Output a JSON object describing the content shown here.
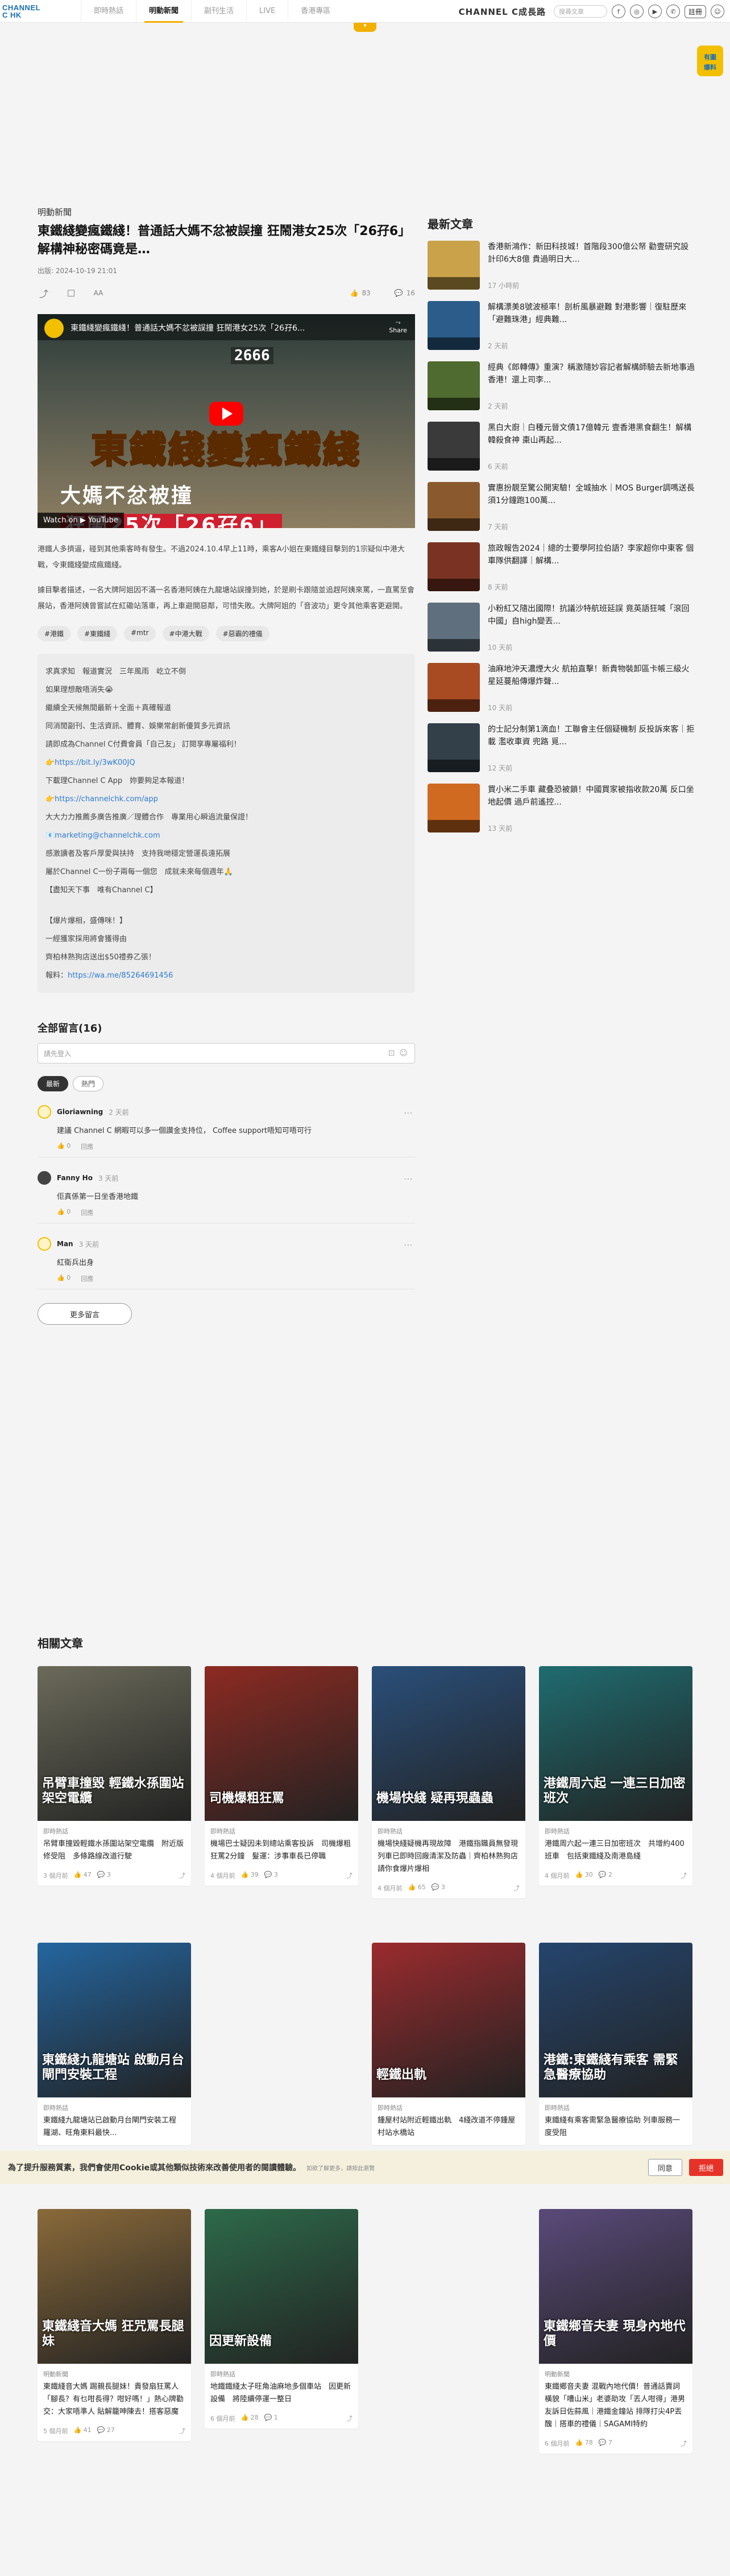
{
  "nav": {
    "logo_line1": "CHANNEL",
    "logo_line2": "C HK",
    "tabs": [
      {
        "label": "即時熱話"
      },
      {
        "label": "明動新聞"
      },
      {
        "label": "副刊生活"
      },
      {
        "label": "LIVE"
      },
      {
        "label": "香港專區"
      }
    ],
    "slogan": "CHANNEL C成長路",
    "search_placeholder": "搜尋文章",
    "login": "註冊",
    "promo_badge": "爆料"
  },
  "article": {
    "section": "明動新聞",
    "headline": "東鐵綫變瘋鐵綫！普通話大媽不忿被誤撞 狂鬧港女25次「26孖6」 解構神秘密碼竟是…",
    "pubdate": "出版: 2024-10-19 21:01",
    "likes": "83",
    "comments_count": "16",
    "video": {
      "title": "東鐵綫變瘋鐵綫！普通話大媽不忿被誤撞 狂鬧港女25次「26孖6...",
      "counter": "2666",
      "big_title": "東鐵綫變瘋鐵綫",
      "sub_prefix": "大媽不忿被撞 ",
      "sub_highlight": "狂鬧25次「26孖6」",
      "share": "Share",
      "watch_on": "Watch on ▶ YouTube"
    },
    "paragraphs": [
      "港鐵人多擠逼，碰到其他乘客時有發生。不過2024.10.4早上11時，乘客A小姐在東鐵綫目擊到的1宗疑似中港大戰，令東鐵綫變成瘋鐵綫。",
      "據目擊者描述，一名大牌阿姐因不滿一名香港阿姨在九龍塘站誤撞到她，於是刷卡跟隨並追趕阿姨來罵，一直罵至會展站，香港阿姨曾嘗試在紅磡站落車，再上車避開惡鄰，可惜失敗。大牌阿姐的「音波功」更令其他乘客更避開。"
    ],
    "tags": [
      "#港鐵",
      "#東鐵綫",
      "#mtr",
      "#中港大戰",
      "#惡霸的禮儀"
    ],
    "promo_lines": [
      "求真求知　報道實況　三年風雨　屹立不倒",
      "如果理想敵唔消失😭",
      "繼續全天候無間最新＋全面＋真確報道",
      "同消閒副刊、生活資訊、體育、娛樂常創新優質多元資訊",
      "請即成為Channel C付費會員「自己友」 訂閱享專屬福利！",
      "👉https://bit.ly/3wK00JQ",
      "下載理Channel C App　妳要夠足本報道！",
      "👉https://channelchk.com/app",
      "大大力力推薦多廣告推廣／理體合作　專業用心瞬過流量保證！",
      "📧marketing@channelchk.com",
      "感激讀者及客戶厚愛與扶持　支持我哋穩定營運長遠拓展",
      "屬於Channel C一份子兩每一個您　成就未來每個週年🙏",
      "【盡知天下事　唯有Channel C】"
    ],
    "tip_lines": [
      "【爆片爆相，盛傳咪！】",
      "一經獲家採用將會獲得由",
      "齊柏林熟狗店送出$50禮券乙張！",
      "報料："
    ],
    "tip_link": "https://wa.me/85264691456"
  },
  "comments": {
    "title": "全部留言(16)",
    "placeholder": "請先登入",
    "sort": [
      "最新",
      "熱門"
    ],
    "items": [
      {
        "user": "Gloriawning",
        "time": "2 天前",
        "text": "建議 Channel C 網暇可以多一個讚金支持位， Coffee support唔知可唔可行",
        "likes": "0",
        "reply": "回應"
      },
      {
        "user": "Fanny Ho",
        "time": "3 天前",
        "text": "佢真係第一日坐香港地鐵",
        "likes": "0",
        "reply": "回應"
      },
      {
        "user": "Man",
        "time": "3 天前",
        "text": "紅衛兵出身",
        "likes": "0",
        "reply": "回應"
      }
    ],
    "more": "更多留言"
  },
  "sidebar": {
    "title": "最新文章",
    "items": [
      {
        "title": "香港新鴻作：新田科技城！首階段300億公帑 勸壹研究設計印6大8億 貴過明日大...",
        "time": "17 小時前",
        "color": "#c9a24a"
      },
      {
        "title": "解構漂美8號波極率！剖析風暴避難 對港影響｜復駐歷來「避難珠港」經典難...",
        "time": "2 天前",
        "color": "#2c5d8a"
      },
      {
        "title": "經典《郎轉傳》重演？稱激隨妙容記者解構師驗去新地事過香港！還上司李...",
        "time": "2 天前",
        "color": "#4f6b2f"
      },
      {
        "title": "黑白大廚｜白種元晉文債17億韓元 壹香港黑食翻生！解構韓殺食神 棗山再起...",
        "time": "6 天前",
        "color": "#3a3a3a"
      },
      {
        "title": "實惠扮靚至驚公開実驗！全城抽水｜MOS Burger調嗎送長 須1分鐘跑100萬...",
        "time": "7 天前",
        "color": "#8a5a2e"
      },
      {
        "title": "旅政報告2024｜總的士要學阿拉伯語？李家超你中東客 個車隊供翻譯｜解構...",
        "time": "8 天前",
        "color": "#7a3322"
      },
      {
        "title": "小粉紅又隨出國際！抗議沙特航班延誤 竟英語狂喊「滾回中國」自high變丟...",
        "time": "10 天前",
        "color": "#5f6f7d"
      },
      {
        "title": "油麻地沖天濃煙大火 航拍直擊！新貴物裝卸區卡帳三級火 星延蔓船傳爆炸聲...",
        "time": "10 天前",
        "color": "#a84a22"
      },
      {
        "title": "的士記分制第1滴血！工聯會主任個疑機制 反投訴來客｜拒載 濫收車資 兜路 覓...",
        "time": "12 天前",
        "color": "#33404a"
      },
      {
        "title": "買小米二手車 藏叠恐被鎖！中國買家被指收款20萬 反口坐地起價 過戶前遙控...",
        "time": "13 天前",
        "color": "#d06a20"
      }
    ]
  },
  "related": {
    "title": "相關文章",
    "cards": [
      {
        "section": "即時熱話",
        "title": "吊臂車撞毀輕鐵水孫圍站架空電纜　附近版修受阻　多條路線改道行駛",
        "date": "3 個月前",
        "likes": "47",
        "comments": "3",
        "caption": "吊臂車撞毀 輕鐵水孫圍站架空電纜",
        "color": "#6b6a5a"
      },
      {
        "section": "即時熱話",
        "title": "機場巴士疑因未到總站乘客投訴　司機爆粗狂罵2分鐘　髮運：涉事車長已停職",
        "date": "4 個月前",
        "likes": "39",
        "comments": "3",
        "caption": "司機爆粗狂罵",
        "color": "#8d2a22"
      },
      {
        "section": "即時熱話",
        "title": "機場快綫疑機再現故障　港鐵指職員無發現　列車已即時回廠清潔及防蟲｜齊柏林熟狗店請你食爆片爆相",
        "date": "4 個月前",
        "likes": "65",
        "comments": "3",
        "caption": "機場快綫 疑再現蟲蟲",
        "color": "#2a4f7a"
      },
      {
        "section": "即時熱話",
        "title": "港鐵周六起一連三日加密班次　共增約400班車　包括東鐵綫及南港島綫",
        "date": "4 個月前",
        "likes": "30",
        "comments": "2",
        "caption": "港鐵周六起 一連三日加密班次",
        "color": "#1f6c70"
      },
      {
        "section": "即時熱話",
        "title": "東鐵綫九龍塘站已啟動月台閘門安裝工程　羅湖、旺角東料最快...",
        "date": "",
        "likes": "",
        "comments": "",
        "caption": "東鐵綫九龍塘站 啟動月台閘門安裝工程",
        "color": "#2466a0"
      },
      {
        "section": "即時熱話",
        "title": "鍾屋村站附近輕鐵出軌　4綫改道不停鍾屋村站水橋站",
        "date": "",
        "likes": "",
        "comments": "",
        "caption": "輕鐵出軌",
        "color": "#9b2b2e"
      },
      {
        "section": "即時熱話",
        "title": "東鐵綫有乘客需緊急醫療協助 列車服務一度受阻",
        "date": "",
        "likes": "",
        "comments": "",
        "caption": "港鐵:東鐵綫有乘客 需緊急醫療協助",
        "color": "#25456d"
      },
      {
        "section": "明動新聞",
        "title": "東鐵綫音大媽 踢親長腿妹！貴發扇狂罵人「腳長？有乜咁長得？咁好嗎！」熱心牌勸交：大家唔準人 貼解籠呻陳去！搭客惡魔",
        "date": "5 個月前",
        "likes": "41",
        "comments": "27",
        "caption": "東鐵綫音大媽 狂咒罵長腿妹",
        "color": "#8a6a3a"
      },
      {
        "section": "即時熱話",
        "title": "地鐵鐵綫太子旺角油麻地多個車站　因更新設備　將陸續停運一整日",
        "date": "6 個月前",
        "likes": "28",
        "comments": "1",
        "caption": "因更新設備",
        "color": "#2d6a4a"
      },
      {
        "section": "明動新聞",
        "title": "東鐵鄉音夫妻 混戰內地代價！普通話賣詞橫貌「嘈山米」老婆助攻「丟人咁得」港男友訴日佐蒜風｜港鐵金鐘站 排隊打尖4P丟醜｜搭車的禮儀｜SAGAMI特約",
        "date": "6 個月前",
        "likes": "78",
        "comments": "7",
        "caption": "東鐵鄉音夫妻 現身內地代價",
        "color": "#5a4a7a"
      }
    ]
  },
  "cookie": {
    "text": "為了提升服務質素，我們會使用Cookie或其他類似技術來改善使用者的閱讀體驗。",
    "small": "如欲了解更多，請按此瀏覽",
    "accept": "同意",
    "reject": "拒絕"
  },
  "colors": {
    "accent": "#f2b000",
    "link": "#2d7bd1",
    "reject": "#e63329"
  }
}
